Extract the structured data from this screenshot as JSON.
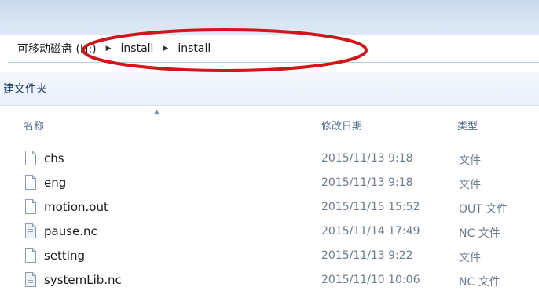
{
  "address_bar": {
    "crumbs": [
      "可移动磁盘 (H:)",
      "install",
      "install"
    ]
  },
  "command_bar": {
    "new_folder_label": "建文件夹"
  },
  "columns": {
    "name": "名称",
    "date_modified": "修改日期",
    "type": "类型"
  },
  "files": [
    {
      "name": "chs",
      "date": "2015/11/13 9:18",
      "type": "文件",
      "icon": "blank-file-icon"
    },
    {
      "name": "eng",
      "date": "2015/11/13 9:18",
      "type": "文件",
      "icon": "blank-file-icon"
    },
    {
      "name": "motion.out",
      "date": "2015/11/15 15:52",
      "type": "OUT 文件",
      "icon": "blank-file-icon"
    },
    {
      "name": "pause.nc",
      "date": "2015/11/14 17:49",
      "type": "NC 文件",
      "icon": "text-file-icon"
    },
    {
      "name": "setting",
      "date": "2015/11/13 9:22",
      "type": "文件",
      "icon": "blank-file-icon"
    },
    {
      "name": "systemLib.nc",
      "date": "2015/11/10 10:06",
      "type": "NC 文件",
      "icon": "text-file-icon"
    }
  ],
  "colors": {
    "highlight_ellipse": "#d0161b",
    "header_text": "#4d6a8a",
    "band": "#d8e5f3"
  }
}
